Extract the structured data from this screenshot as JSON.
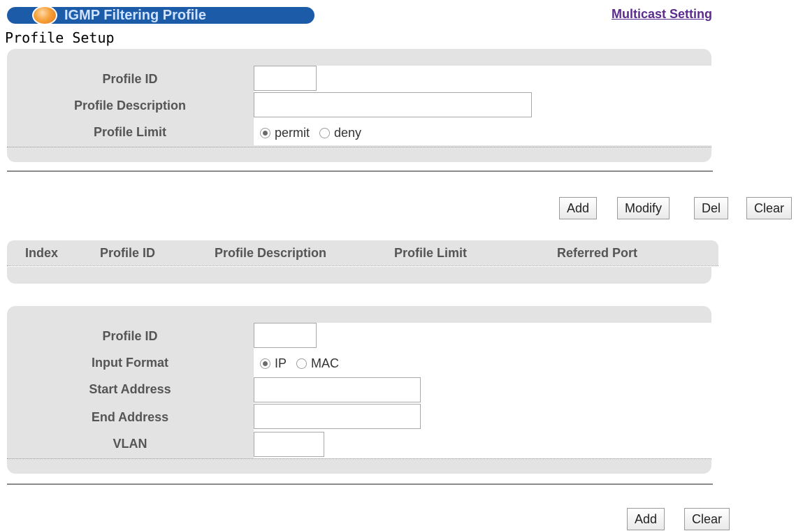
{
  "header": {
    "title": "IGMP Filtering Profile",
    "link": "Multicast Setting",
    "section": "Profile Setup"
  },
  "profile_form": {
    "profile_id_label": "Profile ID",
    "profile_id_value": "",
    "description_label": "Profile Description",
    "description_value": "",
    "limit_label": "Profile Limit",
    "limit_options": [
      "permit",
      "deny"
    ],
    "limit_selected": "permit"
  },
  "profile_buttons": {
    "add": "Add",
    "modify": "Modify",
    "del": "Del",
    "clear": "Clear"
  },
  "profile_table": {
    "columns": [
      "Index",
      "Profile ID",
      "Profile Description",
      "Profile Limit",
      "Referred Port"
    ],
    "rows": []
  },
  "range_form": {
    "profile_id_label": "Profile ID",
    "profile_id_value": "",
    "input_format_label": "Input Format",
    "input_format_options": [
      "IP",
      "MAC"
    ],
    "input_format_selected": "IP",
    "start_label": "Start Address",
    "start_value": "",
    "end_label": "End Address",
    "end_value": "",
    "vlan_label": "VLAN",
    "vlan_value": ""
  },
  "range_buttons": {
    "add": "Add",
    "clear": "Clear"
  },
  "colors": {
    "title_bar": "#1c5ba8",
    "panel": "#e3e3e3",
    "link": "#5b2b8e"
  }
}
